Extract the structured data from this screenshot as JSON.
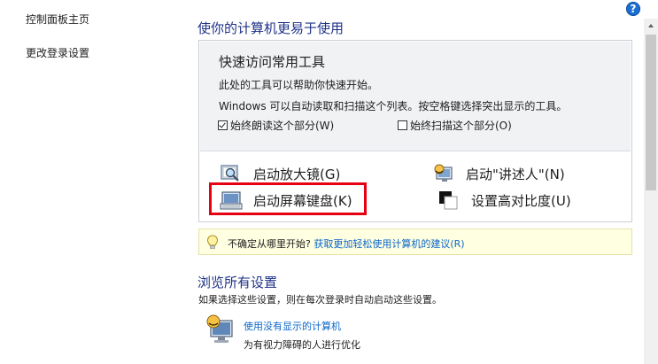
{
  "sidebar": {
    "home": "控制面板主页",
    "login_settings": "更改登录设置"
  },
  "header": {
    "help_glyph": "?"
  },
  "main": {
    "title": "使你的计算机更易于使用",
    "quick_access": {
      "title": "快速访问常用工具",
      "line1": "此处的工具可以帮助你快速开始。",
      "line2": "Windows 可以自动读取和扫描这个列表。按空格键选择突出显示的工具。",
      "checkbox_read": {
        "label": "始终朗读这个部分(W)",
        "checked": true
      },
      "checkbox_scan": {
        "label": "始终扫描这个部分(O)",
        "checked": false
      },
      "tools": {
        "magnifier": "启动放大镜(G)",
        "narrator": "启动\"讲述人\"(N)",
        "osk": "启动屏幕键盘(K)",
        "contrast": "设置高对比度(U)"
      }
    },
    "hint": {
      "prefix": "不确定从哪里开始?",
      "link": "获取更加轻松使用计算机的建议(R)"
    },
    "browse": {
      "title": "浏览所有设置",
      "desc": "如果选择这些设置，则在每次登录时自动启动这些设置。",
      "items": [
        {
          "link": "使用没有显示的计算机",
          "desc": "为有视力障碍的人进行优化"
        }
      ]
    }
  },
  "colors": {
    "heading": "#1e3287",
    "link": "#0b66c8",
    "highlight_border": "#e60012",
    "hint_bg": "#ffffe1"
  }
}
